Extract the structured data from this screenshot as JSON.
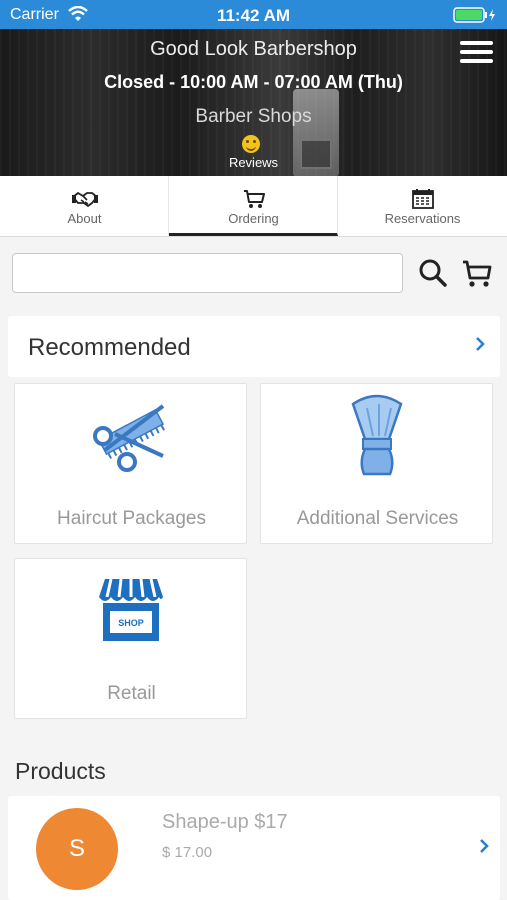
{
  "status_bar": {
    "carrier": "Carrier",
    "time": "11:42 AM"
  },
  "header": {
    "shop_name": "Good Look Barbershop",
    "hours": "Closed - 10:00 AM - 07:00 AM (Thu)",
    "category": "Barber Shops",
    "reviews_label": "Reviews",
    "menu_icon": "hamburger-menu-icon"
  },
  "tabs": [
    {
      "label": "About",
      "icon": "handshake-icon",
      "active": false
    },
    {
      "label": "Ordering",
      "icon": "cart-icon",
      "active": true
    },
    {
      "label": "Reservations",
      "icon": "calendar-icon",
      "active": false
    }
  ],
  "search": {
    "value": "",
    "placeholder": "",
    "search_icon": "search-icon",
    "cart_icon": "cart-icon"
  },
  "recommended": {
    "title": "Recommended"
  },
  "categories": [
    {
      "label": "Haircut Packages",
      "icon": "scissors-comb-icon"
    },
    {
      "label": "Additional Services",
      "icon": "shaving-brush-icon"
    },
    {
      "label": "Retail",
      "icon": "shop-storefront-icon",
      "sign": "SHOP"
    }
  ],
  "products": {
    "heading": "Products",
    "items": [
      {
        "initial": "S",
        "name": "Shape-up $17",
        "price": "$ 17.00"
      }
    ]
  },
  "colors": {
    "status_bar": "#2b8bd9",
    "accent_blue": "#2a7fd4",
    "avatar_orange": "#ef8833"
  }
}
